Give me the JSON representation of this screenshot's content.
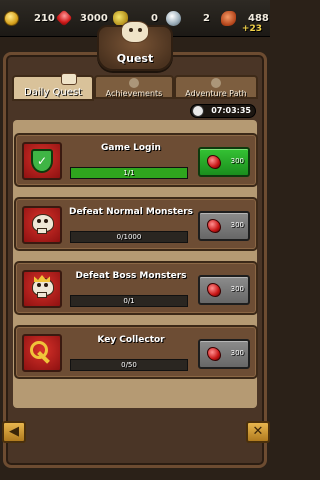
{
  "resources": [
    {
      "icon": "gold-coin-icon",
      "value": "210"
    },
    {
      "icon": "ruby-icon",
      "value": "3000"
    },
    {
      "icon": "coin-bag-icon",
      "value": "0"
    },
    {
      "icon": "orb-icon",
      "value": "2"
    },
    {
      "icon": "meat-icon",
      "value": "488"
    }
  ],
  "meat_bonus": "+23",
  "title": "Quest",
  "tabs": [
    {
      "label": "Daily Quest",
      "active": true
    },
    {
      "label": "Achievements",
      "active": false
    },
    {
      "label": "Adventure Path",
      "active": false
    }
  ],
  "timer": "07:03:35",
  "quests": [
    {
      "title": "Game Login",
      "progress_text": "1/1",
      "progress": 1.0,
      "reward": "300",
      "claimable": true,
      "icon": "shield-check-icon"
    },
    {
      "title": "Defeat Normal Monsters",
      "progress_text": "0/1000",
      "progress": 0.0,
      "reward": "300",
      "claimable": false,
      "icon": "skull-icon"
    },
    {
      "title": "Defeat Boss Monsters",
      "progress_text": "0/1",
      "progress": 0.0,
      "reward": "300",
      "claimable": false,
      "icon": "crowned-skull-icon"
    },
    {
      "title": "Key Collector",
      "progress_text": "0/50",
      "progress": 0.0,
      "reward": "300",
      "claimable": false,
      "icon": "key-icon"
    }
  ],
  "nav": {
    "back_icon": "left-arrow-icon",
    "close_icon": "close-icon",
    "back_label": "◀",
    "close_label": "✕"
  },
  "colors": {
    "claim_green": "#2fa51e",
    "reward_gray": "#777777",
    "panel_brown": "#4a3526"
  }
}
